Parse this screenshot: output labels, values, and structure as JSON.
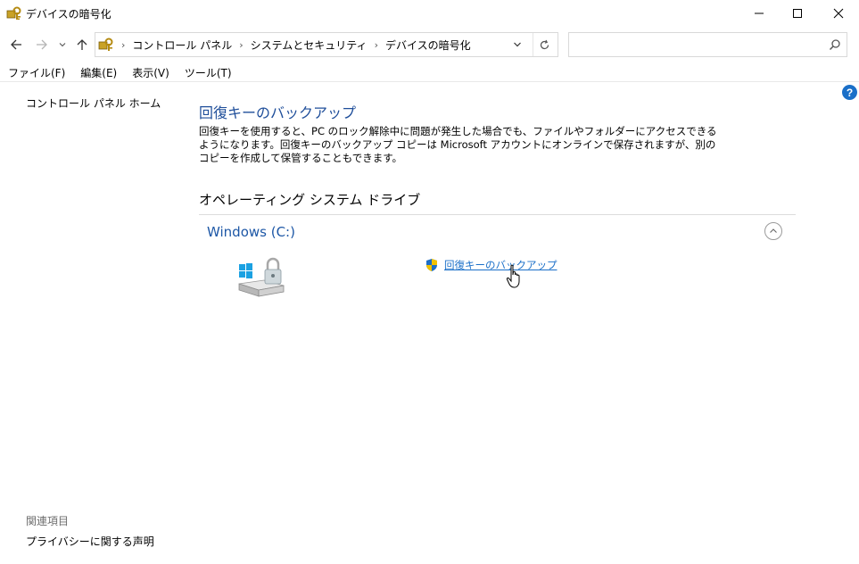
{
  "window": {
    "title": "デバイスの暗号化",
    "controls": {
      "minimize": "minimize-icon",
      "maximize": "maximize-icon",
      "close": "close-icon"
    }
  },
  "address_bar": {
    "breadcrumbs": [
      "コントロール パネル",
      "システムとセキュリティ",
      "デバイスの暗号化"
    ],
    "search_placeholder": ""
  },
  "menu": [
    "ファイル(F)",
    "編集(E)",
    "表示(V)",
    "ツール(T)"
  ],
  "left_pane": {
    "home_link": "コントロール パネル ホーム",
    "related_heading": "関連項目",
    "related_links": [
      "プライバシーに関する声明"
    ]
  },
  "main": {
    "title": "回復キーのバックアップ",
    "description": "回復キーを使用すると、PC のロック解除中に問題が発生した場合でも、ファイルやフォルダーにアクセスできるようになります。回復キーのバックアップ コピーは Microsoft アカウントにオンラインで保存されますが、別のコピーを作成して保管することもできます。",
    "section_title": "オペレーティング システム ドライブ",
    "drive": {
      "name": "Windows (C:)",
      "action_label": "回復キーのバックアップ"
    }
  },
  "colors": {
    "link": "#1a6fc8",
    "heading_blue": "#1f4e9a",
    "help_badge": "#1a6fc8"
  }
}
